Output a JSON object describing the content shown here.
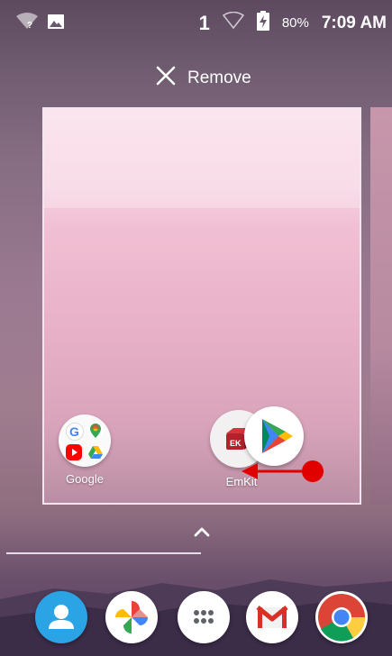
{
  "status_bar": {
    "sim_slot": "1",
    "battery_percent": "80%",
    "time": "7:09 AM",
    "icons": [
      "wifi-unknown-icon",
      "image-notification-icon",
      "signal-icon",
      "battery-charging-icon"
    ]
  },
  "remove_bar": {
    "label": "Remove",
    "icon": "close-icon"
  },
  "workspace": {
    "apps": [
      {
        "label": "Google",
        "icon": "google-folder-icon"
      },
      {
        "label": "EmKit",
        "icon": "emkit-icon"
      }
    ],
    "dragging_icon": "play-store-icon"
  },
  "dock": {
    "icons": [
      "contacts-icon",
      "photos-icon",
      "app-drawer-icon",
      "gmail-icon",
      "chrome-icon"
    ]
  },
  "colors": {
    "annotation_arrow": "#e00000",
    "accent_blue": "#2196f3"
  }
}
